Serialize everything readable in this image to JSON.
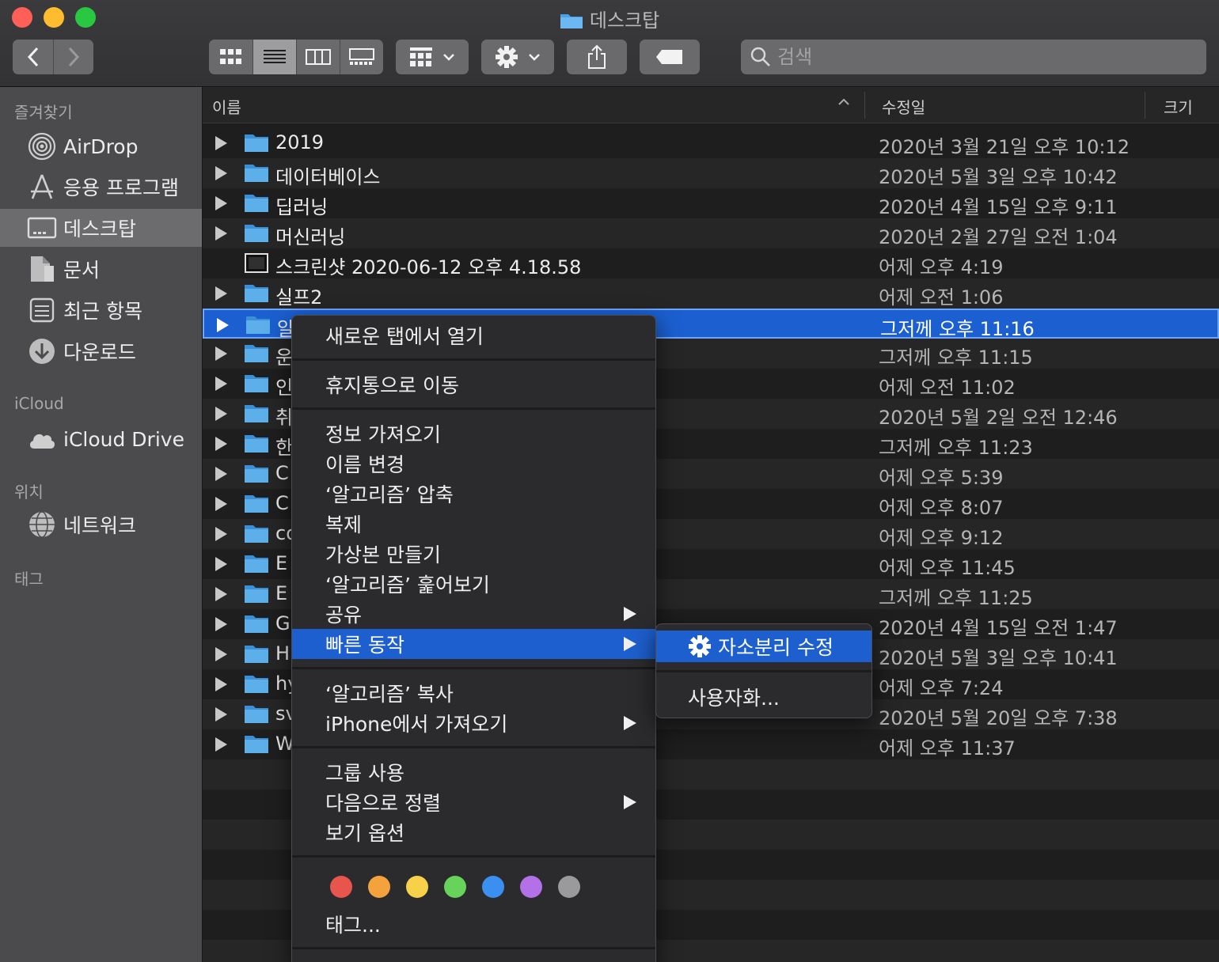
{
  "window": {
    "title": "데스크탑"
  },
  "search": {
    "placeholder": "검색"
  },
  "sidebar": {
    "sections": [
      {
        "label": "즐겨찾기"
      },
      {
        "label": "iCloud"
      },
      {
        "label": "위치"
      },
      {
        "label": "태그"
      }
    ],
    "items": [
      {
        "label": "AirDrop",
        "icon": "airdrop-icon"
      },
      {
        "label": "응용 프로그램",
        "icon": "applications-icon"
      },
      {
        "label": "데스크탑",
        "icon": "desktop-icon",
        "active": true
      },
      {
        "label": "문서",
        "icon": "documents-icon"
      },
      {
        "label": "최근 항목",
        "icon": "recents-icon"
      },
      {
        "label": "다운로드",
        "icon": "downloads-icon"
      },
      {
        "label": "iCloud Drive",
        "icon": "cloud-icon"
      },
      {
        "label": "네트워크",
        "icon": "network-icon"
      }
    ]
  },
  "columns": {
    "name": "이름",
    "date": "수정일",
    "size": "크기"
  },
  "files": [
    {
      "name": "2019",
      "date": "2020년 3월 21일 오후 10:12",
      "type": "folder"
    },
    {
      "name": "데이터베이스",
      "date": "2020년 5월 3일 오후 10:42",
      "type": "folder"
    },
    {
      "name": "딥러닝",
      "date": "2020년 4월 15일 오후 9:11",
      "type": "folder"
    },
    {
      "name": "머신러닝",
      "date": "2020년 2월 27일 오전 1:04",
      "type": "folder"
    },
    {
      "name": "스크린샷 2020-06-12 오후 4.18.58",
      "date": "어제 오후 4:19",
      "type": "image"
    },
    {
      "name": "실프2",
      "date": "어제 오전 1:06",
      "type": "folder"
    },
    {
      "name": "알",
      "date": "그저께 오후 11:16",
      "type": "folder",
      "selected": true
    },
    {
      "name": "운",
      "date": "그저께 오후 11:15",
      "type": "folder"
    },
    {
      "name": "인",
      "date": "어제 오전 11:02",
      "type": "folder"
    },
    {
      "name": "취",
      "date": "2020년 5월 2일 오전 12:46",
      "type": "folder"
    },
    {
      "name": "한",
      "date": "그저께 오후 11:23",
      "type": "folder"
    },
    {
      "name": "C",
      "date": "어제 오후 5:39",
      "type": "folder"
    },
    {
      "name": "C",
      "date": "어제 오후 8:07",
      "type": "folder"
    },
    {
      "name": "co",
      "date": "어제 오후 9:12",
      "type": "folder"
    },
    {
      "name": "E",
      "date": "어제 오후 11:45",
      "type": "folder"
    },
    {
      "name": "E",
      "date": "그저께 오후 11:25",
      "type": "folder"
    },
    {
      "name": "G",
      "date": "2020년 4월 15일 오전 1:47",
      "type": "folder"
    },
    {
      "name": "H",
      "date": "2020년 5월 3일 오후 10:41",
      "type": "folder"
    },
    {
      "name": "hy",
      "date": "어제 오후 7:24",
      "type": "folder"
    },
    {
      "name": "sv",
      "date": "2020년 5월 20일 오후 7:38",
      "type": "folder"
    },
    {
      "name": "W",
      "date": "어제 오후 11:37",
      "type": "folder"
    }
  ],
  "context_menu": {
    "open_new_tab": "새로운 탭에서 열기",
    "move_to_trash": "휴지통으로 이동",
    "get_info": "정보 가져오기",
    "rename": "이름 변경",
    "compress": "‘알고리즘’ 압축",
    "duplicate": "복제",
    "make_alias": "가상본 만들기",
    "quick_look": "‘알고리즘’ 훑어보기",
    "share": "공유",
    "quick_actions": "빠른 동작",
    "copy": "‘알고리즘’ 복사",
    "import_iphone": "iPhone에서 가져오기",
    "use_groups": "그룹 사용",
    "sort_by": "다음으로 정렬",
    "view_options": "보기 옵션",
    "tags": "태그...",
    "tag_colors": [
      "#e8554c",
      "#f4a23c",
      "#f7d14a",
      "#67d35b",
      "#3b8ff0",
      "#b470e6",
      "#9a9a9c"
    ]
  },
  "submenu": {
    "jamo_fix": "자소분리 수정",
    "customize": "사용자화..."
  }
}
